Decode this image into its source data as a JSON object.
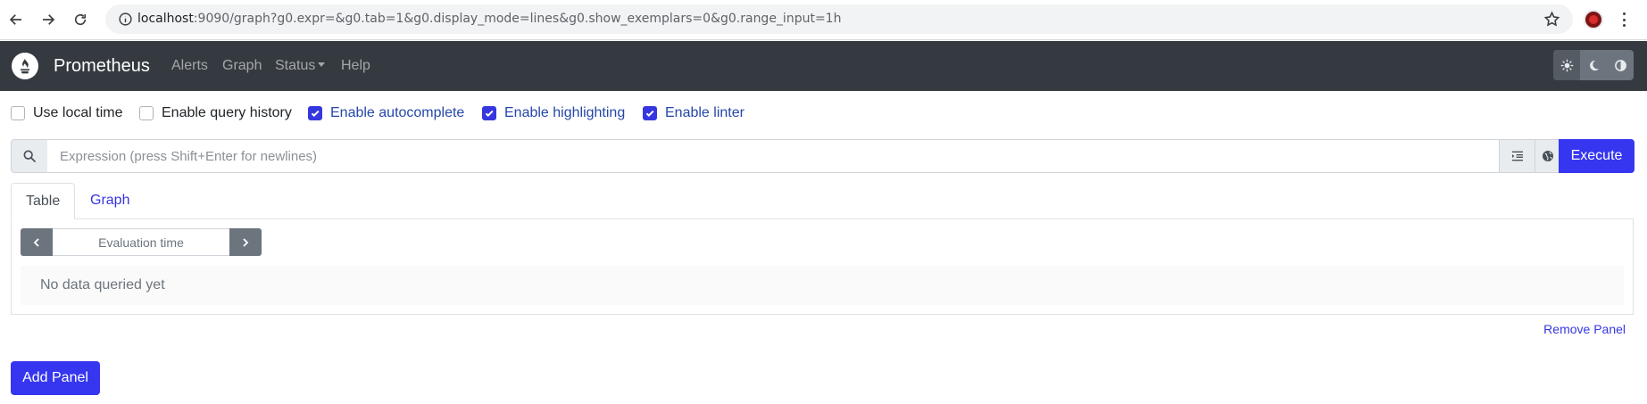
{
  "browser": {
    "url_host": "localhost",
    "url_rest": ":9090/graph?g0.expr=&g0.tab=1&g0.display_mode=lines&g0.show_exemplars=0&g0.range_input=1h"
  },
  "navbar": {
    "brand": "Prometheus",
    "links": [
      "Alerts",
      "Graph",
      "Status",
      "Help"
    ]
  },
  "options": [
    {
      "label": "Use local time",
      "checked": false
    },
    {
      "label": "Enable query history",
      "checked": false
    },
    {
      "label": "Enable autocomplete",
      "checked": true
    },
    {
      "label": "Enable highlighting",
      "checked": true
    },
    {
      "label": "Enable linter",
      "checked": true
    }
  ],
  "expression": {
    "placeholder": "Expression (press Shift+Enter for newlines)",
    "value": "",
    "execute_label": "Execute"
  },
  "tabs": {
    "table": "Table",
    "graph": "Graph",
    "active": "Table"
  },
  "panel": {
    "eval_placeholder": "Evaluation time",
    "no_data": "No data queried yet",
    "remove_label": "Remove Panel"
  },
  "add_panel_label": "Add Panel",
  "colors": {
    "navbar": "#343a40",
    "primary": "#3636f0",
    "link": "#3636e0"
  }
}
